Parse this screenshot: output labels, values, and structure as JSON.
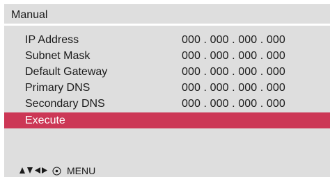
{
  "menu": {
    "title": "Manual",
    "rows": [
      {
        "label": "IP Address",
        "value": "000 . 000 . 000 . 000"
      },
      {
        "label": "Subnet Mask",
        "value": "000 . 000 . 000 . 000"
      },
      {
        "label": "Default Gateway",
        "value": "000 . 000 . 000 . 000"
      },
      {
        "label": "Primary DNS",
        "value": "000 . 000 . 000 . 000"
      },
      {
        "label": "Secondary DNS",
        "value": "000 . 000 . 000 . 000"
      }
    ],
    "execute_label": "Execute"
  },
  "footer": {
    "nav_icon": "arrows-up-down-left-right-icon",
    "enter_icon": "enter-circle-icon",
    "menu_label": "MENU"
  },
  "colors": {
    "background": "#dedede",
    "highlight": "#cc3756",
    "text": "#1a1a1a"
  }
}
